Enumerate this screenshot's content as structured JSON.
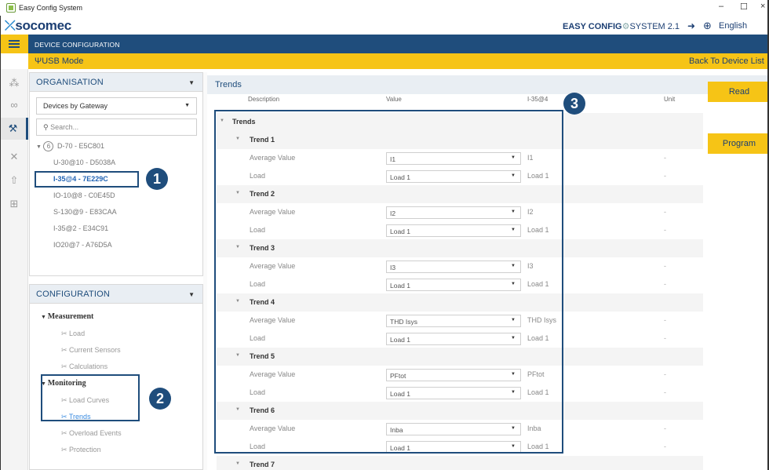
{
  "window": {
    "title": "Easy Config System",
    "minimize": "–",
    "maximize": "☐",
    "close": "×"
  },
  "brand": {
    "logo": "socomec",
    "product_bold": "EASY CONFIG",
    "product_thin": "SYSTEM 2.1",
    "language": "English"
  },
  "nav": {
    "title": "DEVICE CONFIGURATION"
  },
  "usbbar": {
    "mode": "USB Mode",
    "back": "Back To Device List"
  },
  "organisation": {
    "title": "ORGANISATION",
    "gateway_select": "Devices by Gateway",
    "search_placeholder": "Search...",
    "root": {
      "count": "6",
      "label": "D-70 - E5C801"
    },
    "devices": [
      "U-30@10 - D5038A",
      "I-35@4 - 7E229C",
      "IO-10@8 - C0E45D",
      "S-130@9 - E83CAA",
      "I-35@2 - E34C91",
      "IO20@7 - A76D5A"
    ],
    "selected_index": 1
  },
  "configuration": {
    "title": "CONFIGURATION",
    "groups": [
      {
        "label": "Measurement",
        "items": [
          "Load",
          "Current Sensors",
          "Calculations"
        ]
      },
      {
        "label": "Monitoring",
        "items": [
          "Load Curves",
          "Trends",
          "Overload Events",
          "Protection"
        ]
      }
    ],
    "active_item": "Trends"
  },
  "main": {
    "title": "Trends",
    "columns": {
      "description": "Description",
      "value": "Value",
      "device": "I-35@4",
      "unit": "Unit"
    },
    "root_label": "Trends",
    "trends": [
      {
        "name": "Trend 1",
        "avg_label": "Average Value",
        "avg_select": "I1",
        "avg_value": "I1",
        "avg_unit": "-",
        "load_label": "Load",
        "load_select": "Load 1",
        "load_value": "Load 1",
        "load_unit": "-"
      },
      {
        "name": "Trend 2",
        "avg_label": "Average Value",
        "avg_select": "I2",
        "avg_value": "I2",
        "avg_unit": "-",
        "load_label": "Load",
        "load_select": "Load 1",
        "load_value": "Load 1",
        "load_unit": "-"
      },
      {
        "name": "Trend 3",
        "avg_label": "Average Value",
        "avg_select": "I3",
        "avg_value": "I3",
        "avg_unit": "-",
        "load_label": "Load",
        "load_select": "Load 1",
        "load_value": "Load 1",
        "load_unit": "-"
      },
      {
        "name": "Trend 4",
        "avg_label": "Average Value",
        "avg_select": "THD Isys",
        "avg_value": "THD Isys",
        "avg_unit": "-",
        "load_label": "Load",
        "load_select": "Load 1",
        "load_value": "Load 1",
        "load_unit": "-"
      },
      {
        "name": "Trend 5",
        "avg_label": "Average Value",
        "avg_select": "PFtot",
        "avg_value": "PFtot",
        "avg_unit": "-",
        "load_label": "Load",
        "load_select": "Load 1",
        "load_value": "Load 1",
        "load_unit": "-"
      },
      {
        "name": "Trend 6",
        "avg_label": "Average Value",
        "avg_select": "Inba",
        "avg_value": "Inba",
        "avg_unit": "-",
        "load_label": "Load",
        "load_select": "Load 1",
        "load_value": "Load 1",
        "load_unit": "-"
      }
    ],
    "next_trend": "Trend 7"
  },
  "actions": {
    "read": "Read",
    "program": "Program"
  },
  "callouts": [
    "1",
    "2",
    "3"
  ]
}
